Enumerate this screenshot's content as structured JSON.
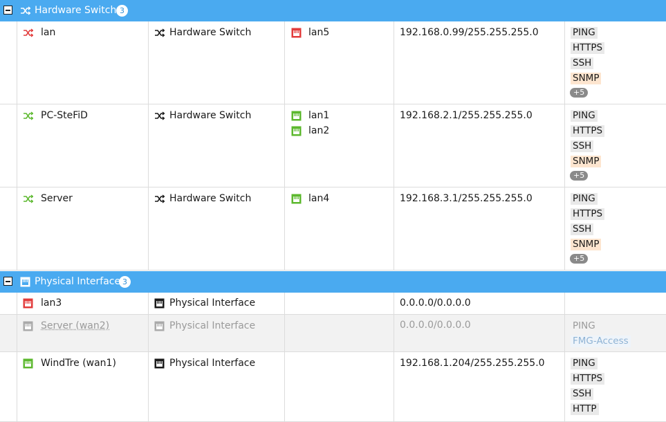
{
  "colors": {
    "header_bg": "#4aaaf0",
    "port_down": "#e23b3b",
    "port_up": "#5cb82e",
    "port_disabled": "#aaaaaa",
    "snmp_tag_bg": "#fde5cf"
  },
  "groups": [
    {
      "label": "Hardware Switch",
      "count": "3",
      "icon": "switch-icon",
      "rows": [
        {
          "name": "lan",
          "name_icon": "switch-icon-red",
          "type": "Hardware Switch",
          "type_icon": "switch-icon-black",
          "members": [
            {
              "label": "lan5",
              "icon": "port-icon-red"
            }
          ],
          "address": "192.168.0.99/255.255.255.0",
          "access": [
            "PING",
            "HTTPS",
            "SSH",
            "SNMP"
          ],
          "more": "+5"
        },
        {
          "name": "PC-SteFiD",
          "name_icon": "switch-icon-green",
          "type": "Hardware Switch",
          "type_icon": "switch-icon-black",
          "members": [
            {
              "label": "lan1",
              "icon": "port-icon-green"
            },
            {
              "label": "lan2",
              "icon": "port-icon-green"
            }
          ],
          "address": "192.168.2.1/255.255.255.0",
          "access": [
            "PING",
            "HTTPS",
            "SSH",
            "SNMP"
          ],
          "more": "+5"
        },
        {
          "name": "Server",
          "name_icon": "switch-icon-green",
          "type": "Hardware Switch",
          "type_icon": "switch-icon-black",
          "members": [
            {
              "label": "lan4",
              "icon": "port-icon-green"
            }
          ],
          "address": "192.168.3.1/255.255.255.0",
          "access": [
            "PING",
            "HTTPS",
            "SSH",
            "SNMP"
          ],
          "more": "+5"
        }
      ]
    },
    {
      "label": "Physical Interface",
      "count": "3",
      "icon": "port-icon-white",
      "rows": [
        {
          "name": "lan3",
          "name_icon": "port-icon-red",
          "type": "Physical Interface",
          "type_icon": "port-icon-black",
          "members": [],
          "address": "0.0.0.0/0.0.0.0",
          "access": []
        },
        {
          "name": "Server (wan2)",
          "name_icon": "port-icon-grey",
          "type": "Physical Interface",
          "type_icon": "port-icon-grey",
          "members": [],
          "address": "0.0.0.0/0.0.0.0",
          "access": [
            "PING",
            "FMG-Access"
          ],
          "disabled": true
        },
        {
          "name": "WindTre (wan1)",
          "name_icon": "port-icon-green",
          "type": "Physical Interface",
          "type_icon": "port-icon-black",
          "members": [],
          "address": "192.168.1.204/255.255.255.0",
          "access": [
            "PING",
            "HTTPS",
            "SSH",
            "HTTP"
          ]
        }
      ]
    }
  ]
}
